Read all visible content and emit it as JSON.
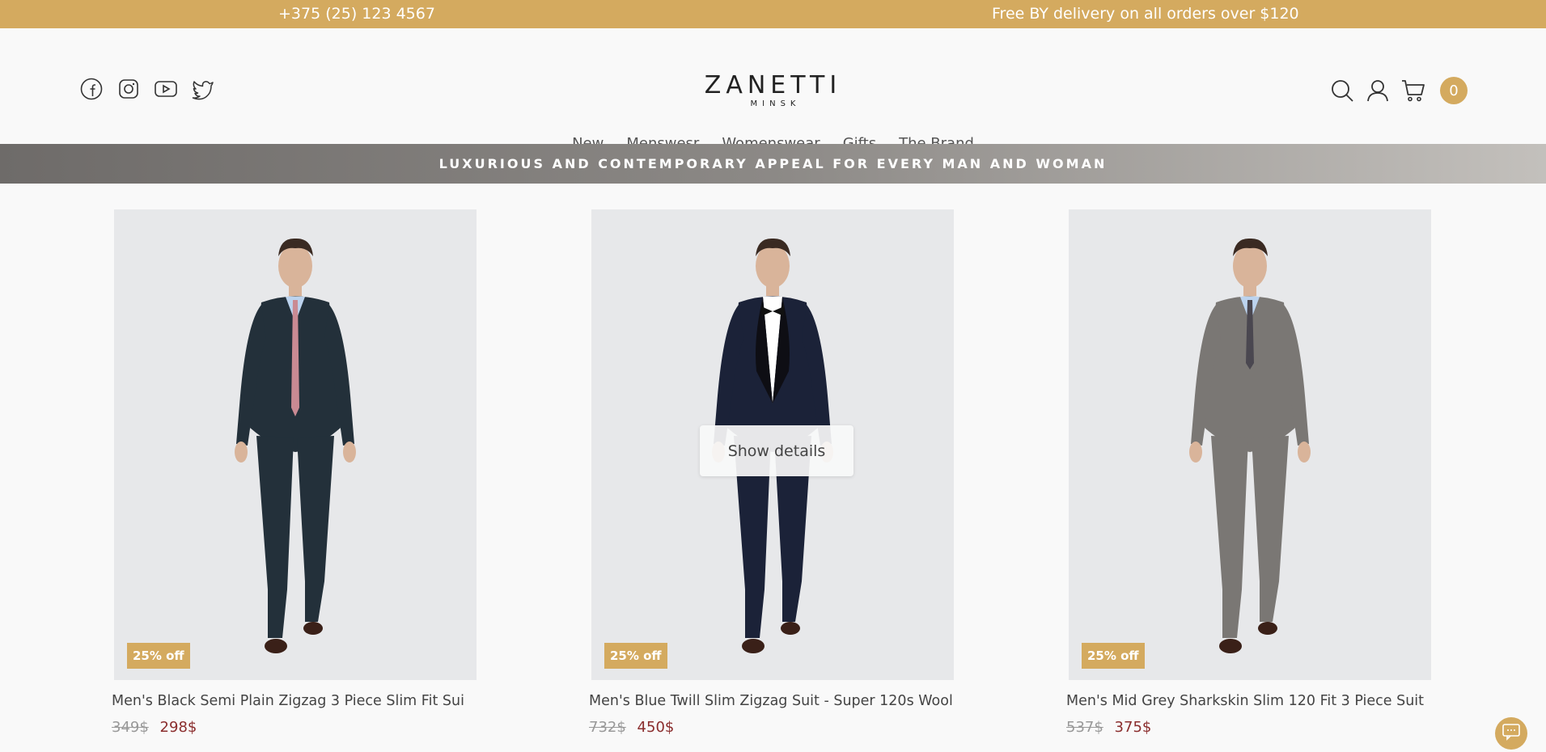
{
  "topbar": {
    "phone": "+375 (25) 123 4567",
    "promo": "Free BY delivery on all orders over $120"
  },
  "header": {
    "brand": "ZANETTI",
    "city": "MINSK",
    "social_icons": [
      "facebook-icon",
      "instagram-icon",
      "youtube-icon",
      "twitter-icon"
    ],
    "tool_icons": [
      "search-icon",
      "user-icon",
      "cart-icon"
    ],
    "cart_count": "0"
  },
  "nav": {
    "items": [
      "New",
      "Menswesr",
      "Womenswear",
      "Gifts",
      "The Brand"
    ]
  },
  "banner": {
    "text": "LUXURIOUS AND CONTEMPORARY APPEAL FOR EVERY MAN AND WOMAN"
  },
  "products": [
    {
      "badge": "25% off",
      "name": "Men's Black Semi Plain Zigzag 3 Piece Slim Fit Sui",
      "old_price": "349$",
      "new_price": "298$",
      "suit_color": "#23303a",
      "tie_color": "#c98a93"
    },
    {
      "badge": "25% off",
      "name": "Men's Blue Twill Slim Zigzag Suit - Super 120s Wool",
      "old_price": "732$",
      "new_price": "450$",
      "suit_color": "#1b2238",
      "tie_color": "#111111",
      "hover_button": "Show details"
    },
    {
      "badge": "25% off",
      "name": "Men's Mid Grey Sharkskin Slim 120 Fit 3 Piece Suit",
      "old_price": "537$",
      "new_price": "375$",
      "suit_color": "#7a7774",
      "tie_color": "#4a4750"
    }
  ],
  "colors": {
    "accent": "#d4aa5f",
    "sale_price": "#8b2e2e"
  }
}
